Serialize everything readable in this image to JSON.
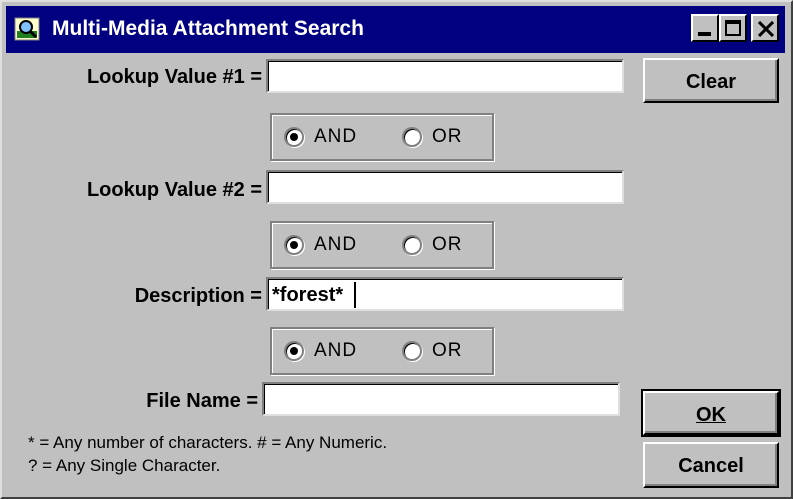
{
  "window": {
    "title": "Multi-Media Attachment Search",
    "icon": "magnifier-picture-icon",
    "controls": [
      "minimize-icon",
      "maximize-icon",
      "close-icon"
    ]
  },
  "fields": {
    "lookup1": {
      "label": "Lookup Value #1 =",
      "value": ""
    },
    "lookup2": {
      "label": "Lookup Value #2 =",
      "value": ""
    },
    "description": {
      "label": "Description =",
      "value": "*forest*"
    },
    "file_name": {
      "label": "File Name =",
      "value": ""
    }
  },
  "operators": [
    {
      "and_label": "AND",
      "or_label": "OR",
      "selected": "AND"
    },
    {
      "and_label": "AND",
      "or_label": "OR",
      "selected": "AND"
    },
    {
      "and_label": "AND",
      "or_label": "OR",
      "selected": "AND"
    }
  ],
  "buttons": {
    "clear": "Clear",
    "ok": "OK",
    "cancel": "Cancel"
  },
  "help": {
    "line1": "* = Any number of characters. # = Any Numeric.",
    "line2": "? = Any Single Character."
  }
}
